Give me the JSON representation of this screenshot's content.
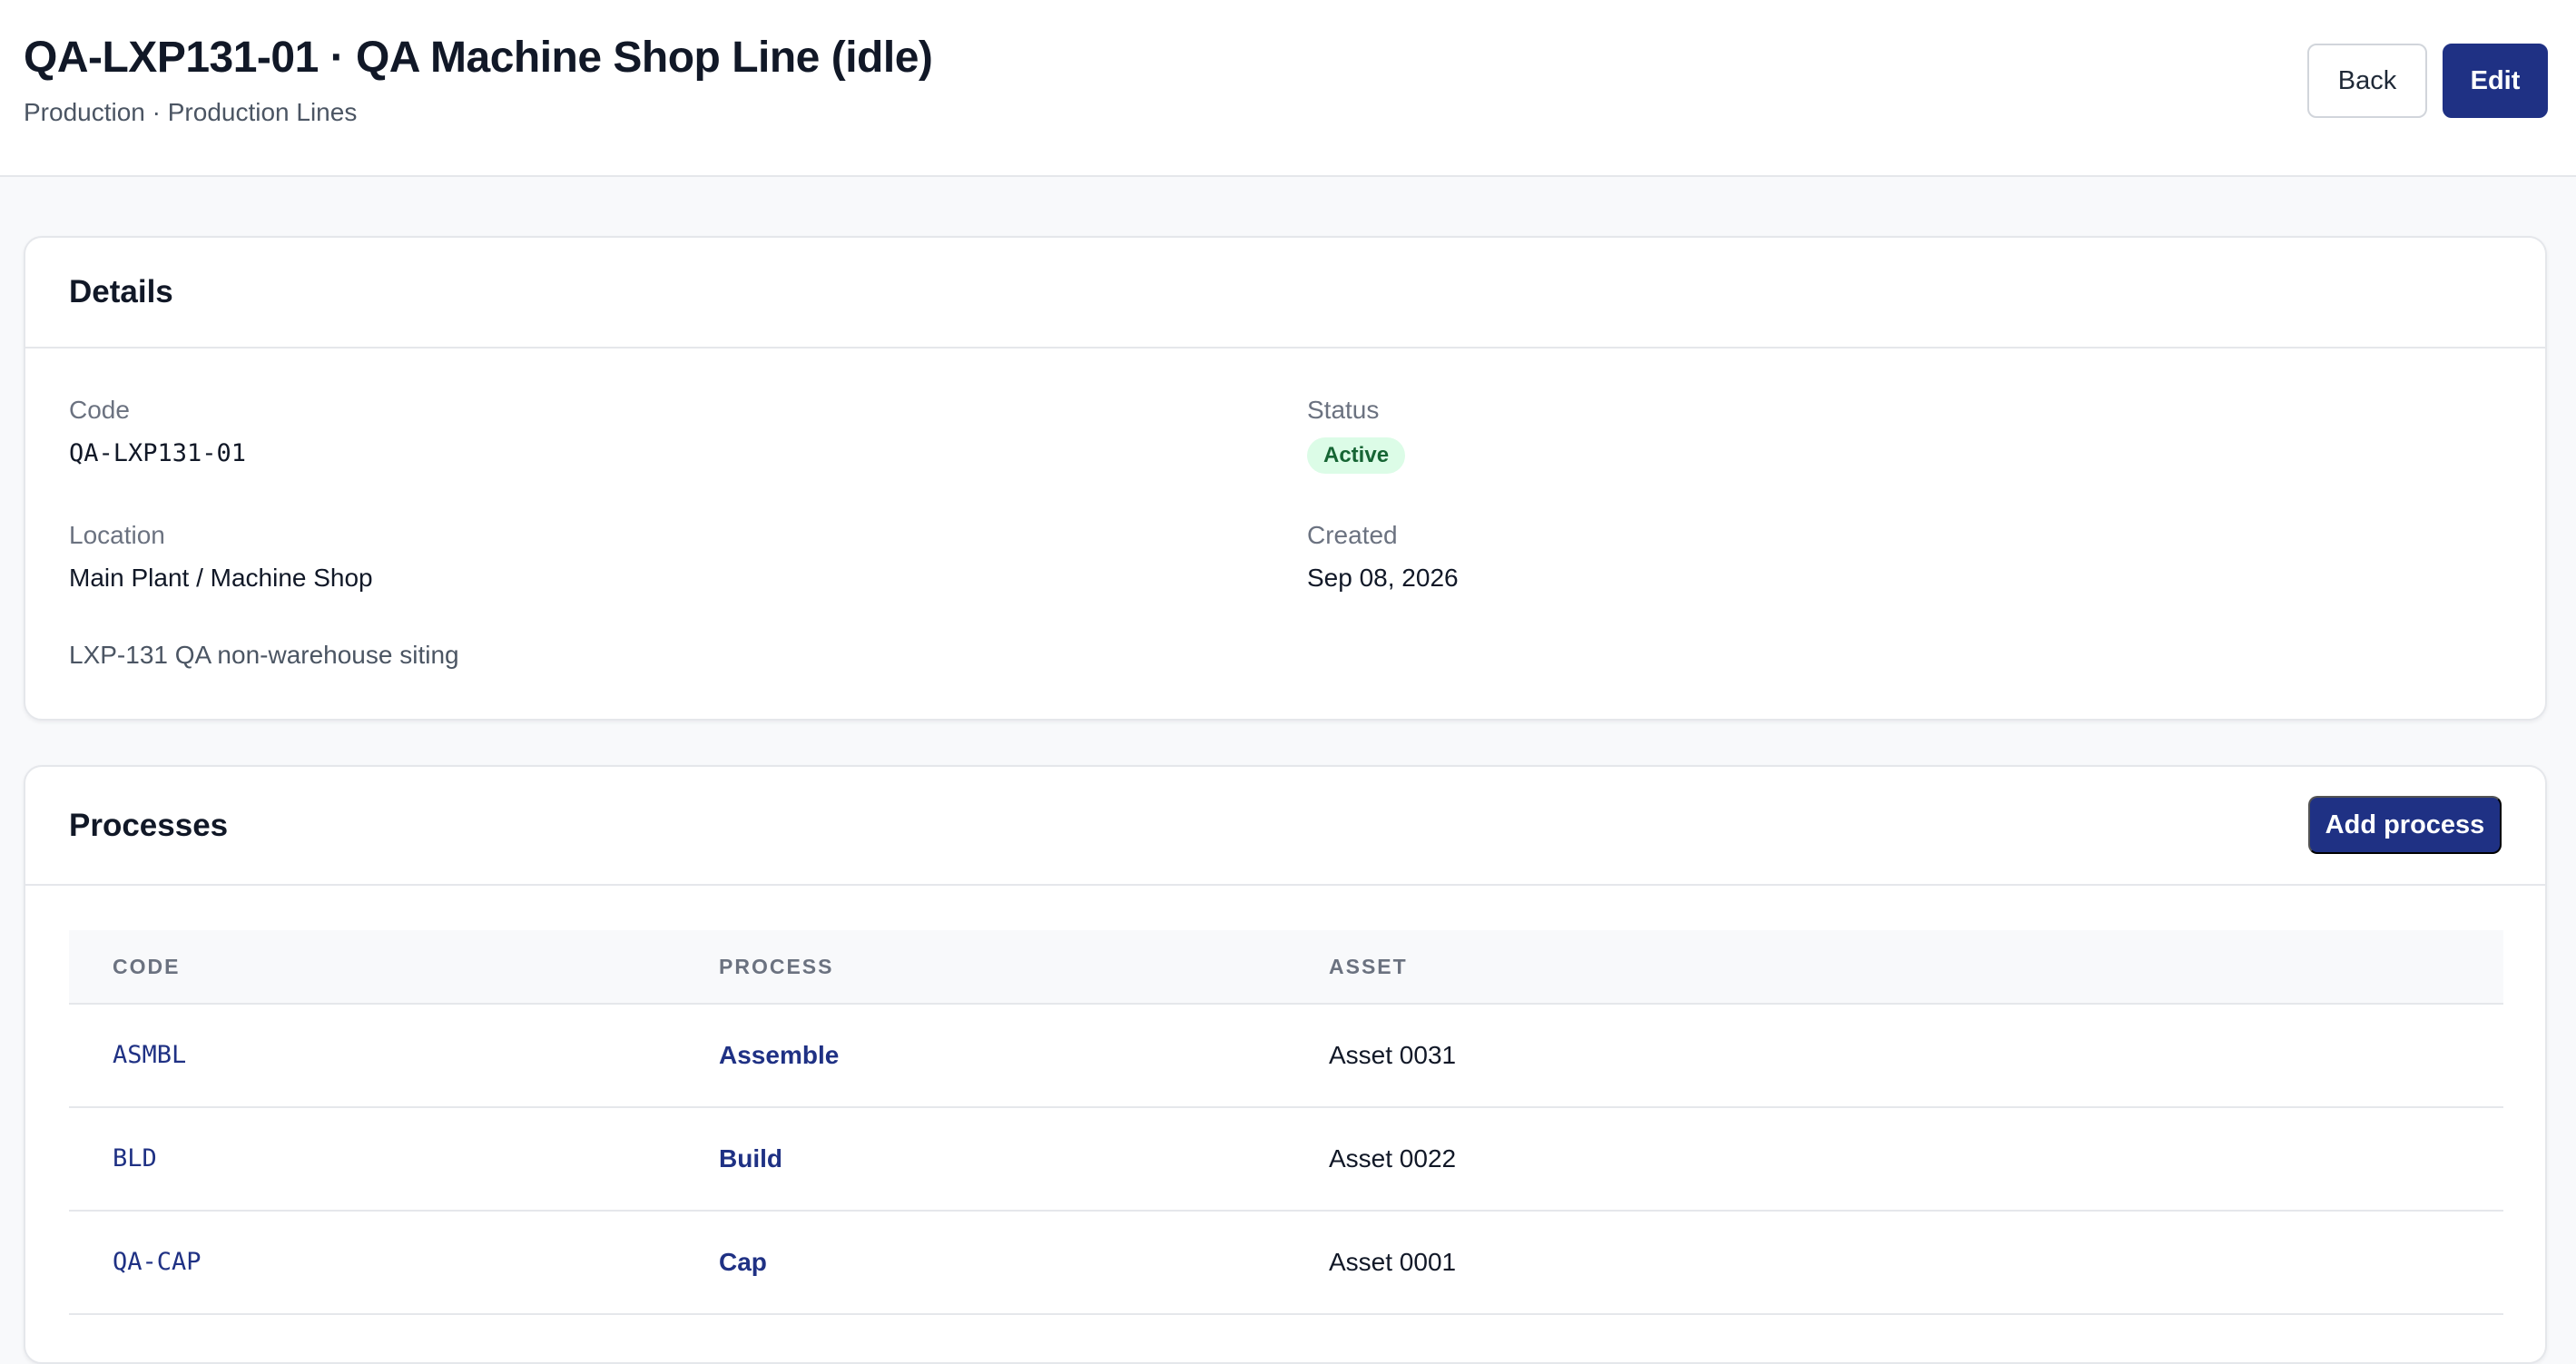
{
  "header": {
    "title": "QA-LXP131-01 · QA Machine Shop Line (idle)",
    "breadcrumb": "Production · Production Lines",
    "back_label": "Back",
    "edit_label": "Edit"
  },
  "details": {
    "section_title": "Details",
    "code_label": "Code",
    "code_value": "QA-LXP131-01",
    "status_label": "Status",
    "status_value": "Active",
    "location_label": "Location",
    "location_value": "Main Plant / Machine Shop",
    "created_label": "Created",
    "created_value": "Sep 08, 2026",
    "note": "LXP-131 QA non-warehouse siting"
  },
  "processes": {
    "section_title": "Processes",
    "add_label": "Add process",
    "columns": [
      "CODE",
      "PROCESS",
      "ASSET"
    ],
    "rows": [
      {
        "code": "ASMBL",
        "process": "Assemble",
        "asset": "Asset 0031"
      },
      {
        "code": "BLD",
        "process": "Build",
        "asset": "Asset 0022"
      },
      {
        "code": "QA-CAP",
        "process": "Cap",
        "asset": "Asset 0001"
      }
    ]
  },
  "colors": {
    "primary": "#1f3184",
    "status_active_bg": "#dcfce7",
    "status_active_text": "#166534"
  }
}
